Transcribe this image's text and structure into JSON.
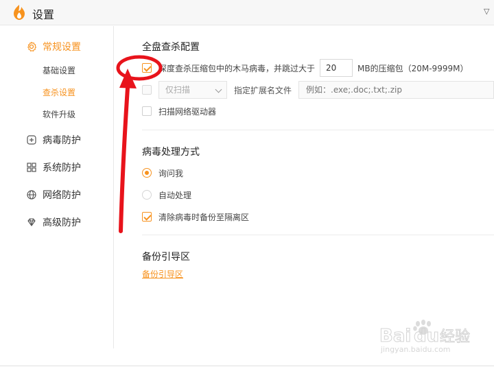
{
  "window": {
    "title": "设置"
  },
  "sidebar": {
    "groups": [
      {
        "label": "常规设置",
        "active": true,
        "icon": "gear-icon",
        "children": [
          {
            "label": "基础设置",
            "active": false
          },
          {
            "label": "查杀设置",
            "active": true
          },
          {
            "label": "软件升级",
            "active": false
          }
        ]
      },
      {
        "label": "病毒防护",
        "active": false,
        "icon": "plus-square-icon"
      },
      {
        "label": "系统防护",
        "active": false,
        "icon": "grid-icon"
      },
      {
        "label": "网络防护",
        "active": false,
        "icon": "globe-icon"
      },
      {
        "label": "高级防护",
        "active": false,
        "icon": "diamond-icon"
      }
    ]
  },
  "sections": {
    "full_scan": {
      "title": "全盘查杀配置",
      "deep_scan": {
        "label_prefix": "深度查杀压缩包中的木马病毒，并跳过大于",
        "value": "20",
        "label_suffix": "MB的压缩包（20M-9999M）",
        "checked": true
      },
      "scan_mode": {
        "selected": "仅扫描",
        "checked": false
      },
      "ext": {
        "label": "指定扩展名文件",
        "placeholder": "例如：.exe;.doc;.txt;.zip"
      },
      "network_drive": {
        "label": "扫描网络驱动器",
        "checked": false
      }
    },
    "virus_handling": {
      "title": "病毒处理方式",
      "options": [
        {
          "label": "询问我",
          "selected": true
        },
        {
          "label": "自动处理",
          "selected": false
        }
      ],
      "backup": {
        "label": "清除病毒时备份至隔离区",
        "checked": true
      }
    },
    "backup_guide": {
      "title": "备份引导区",
      "link": "备份引导区"
    }
  },
  "colors": {
    "accent": "#f7921e",
    "annotation": "#e8131b"
  },
  "watermark": {
    "brand": "Baidu经验",
    "url": "jingyan.baidu.com"
  }
}
